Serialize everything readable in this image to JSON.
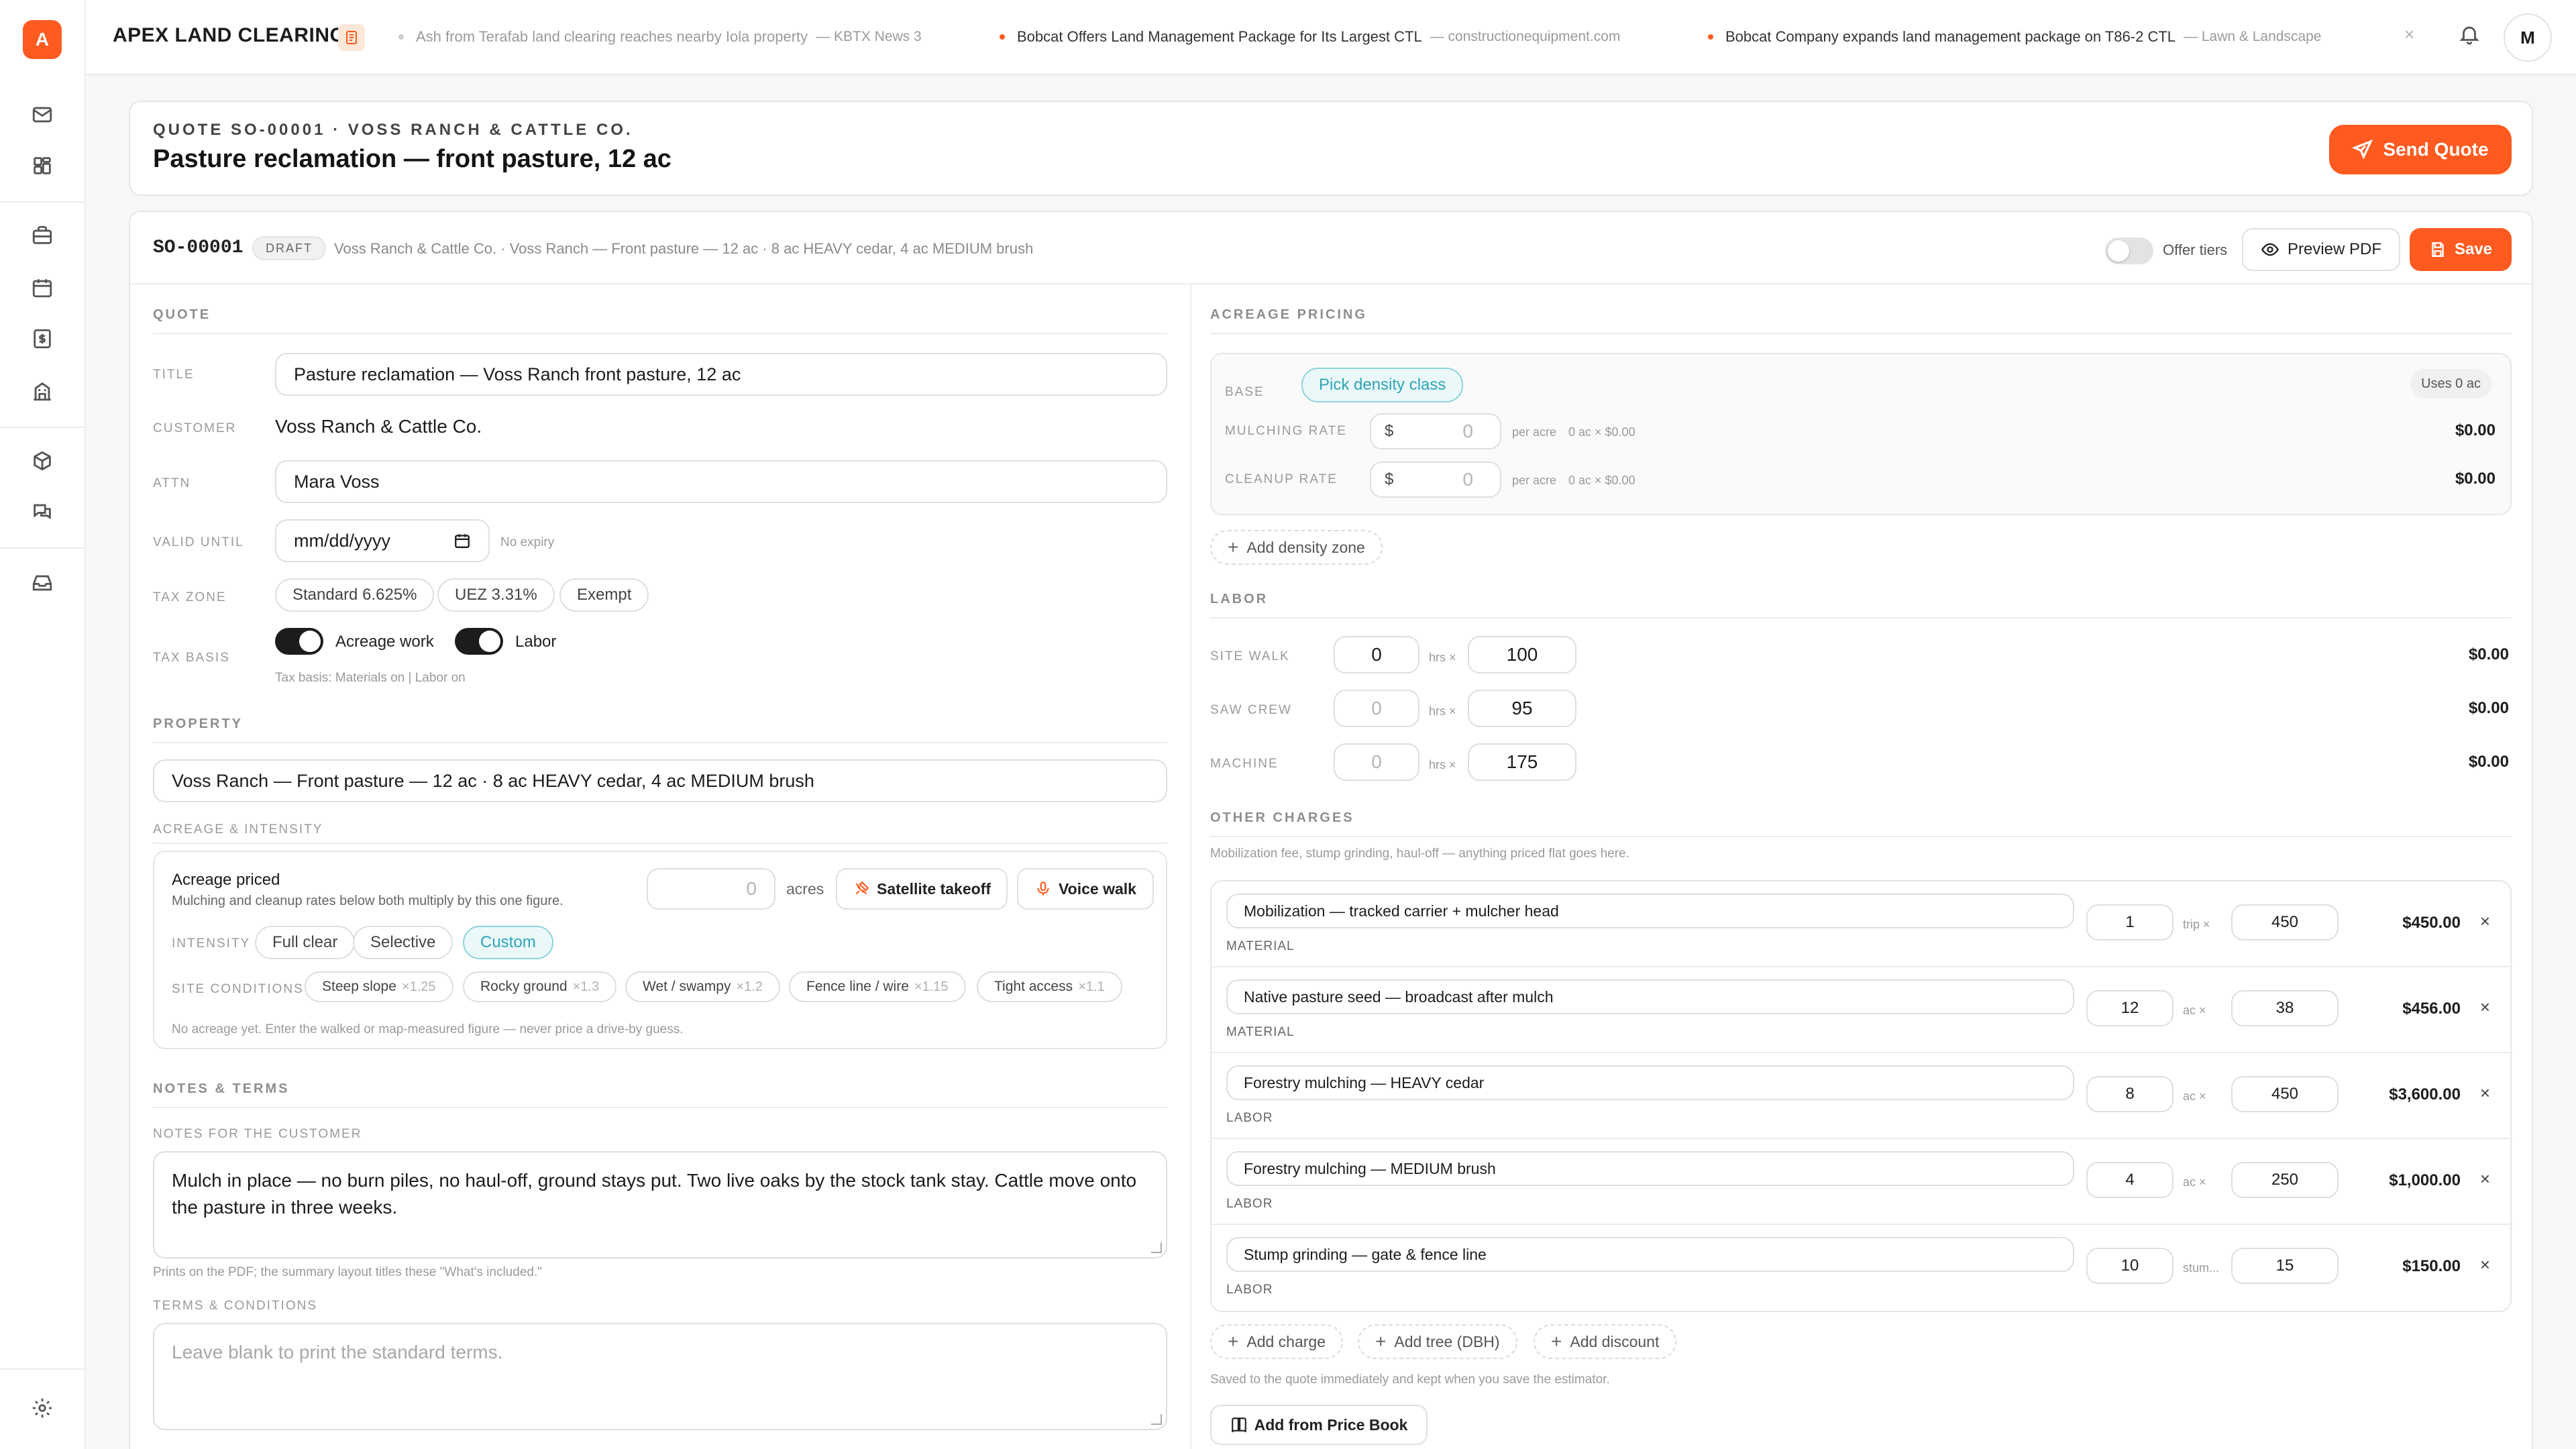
{
  "app": {
    "brand": "APEX LAND CLEARING",
    "logo_letter": "A",
    "avatar": "M"
  },
  "ticker": [
    {
      "headline": "Ash from Terafab land clearing reaches nearby Iola property",
      "source": "— KBTX News 3",
      "dot_color": "#cfcfcf",
      "muted": true
    },
    {
      "headline": "Bobcat Offers Land Management Package for Its Largest CTL",
      "source": "— constructionequipment.com",
      "dot_color": "#ff5a1f",
      "muted": false
    },
    {
      "headline": "Bobcat Company expands land management package on T86-2 CTL",
      "source": "— Lawn & Landscape",
      "dot_color": "#ff5a1f",
      "muted": false
    }
  ],
  "header": {
    "kicker": "QUOTE SO-00001 · VOSS RANCH & CATTLE CO.",
    "title": "Pasture reclamation — front pasture, 12 ac",
    "send_label": "Send Quote"
  },
  "meta": {
    "number": "SO-00001",
    "status": "DRAFT",
    "description": "Voss Ranch & Cattle Co. · Voss Ranch — Front pasture — 12 ac · 8 ac HEAVY cedar, 4 ac MEDIUM brush",
    "offer_tiers_label": "Offer tiers",
    "preview_label": "Preview PDF",
    "save_label": "Save"
  },
  "quote": {
    "section": "QUOTE",
    "title_label": "TITLE",
    "title_value": "Pasture reclamation — Voss Ranch front pasture, 12 ac",
    "customer_label": "CUSTOMER",
    "customer_value": "Voss Ranch & Cattle Co.",
    "attn_label": "ATTN",
    "attn_value": "Mara Voss",
    "valid_label": "VALID UNTIL",
    "valid_placeholder": "mm/dd/yyyy",
    "valid_hint": "No expiry",
    "tax_zone_label": "TAX ZONE",
    "tax_zones": [
      "Standard 6.625%",
      "UEZ 3.31%",
      "Exempt"
    ],
    "tax_basis_label": "TAX BASIS",
    "tax_acreage": "Acreage work",
    "tax_labor": "Labor",
    "tax_hint": "Tax basis: Materials on | Labor on"
  },
  "property": {
    "section": "PROPERTY",
    "value": "Voss Ranch — Front pasture — 12 ac · 8 ac HEAVY cedar, 4 ac MEDIUM brush",
    "acreage_section": "ACREAGE & INTENSITY",
    "acreage_title": "Acreage priced",
    "acreage_sub": "Mulching and cleanup rates below both multiply by this one figure.",
    "acres_value": "0",
    "acres_unit": "acres",
    "satellite_label": "Satellite takeoff",
    "voice_label": "Voice walk",
    "intensity_label": "INTENSITY",
    "intensities": [
      "Full clear",
      "Selective",
      "Custom"
    ],
    "site_label": "SITE CONDITIONS",
    "conditions": [
      {
        "name": "Steep slope",
        "mult": "×1.25"
      },
      {
        "name": "Rocky ground",
        "mult": "×1.3"
      },
      {
        "name": "Wet / swampy",
        "mult": "×1.2"
      },
      {
        "name": "Fence line / wire",
        "mult": "×1.15"
      },
      {
        "name": "Tight access",
        "mult": "×1.1"
      }
    ],
    "acreage_hint": "No acreage yet. Enter the walked or map-measured figure — never price a drive-by guess."
  },
  "notes": {
    "section": "NOTES & TERMS",
    "customer_label": "NOTES FOR THE CUSTOMER",
    "customer_text": "Mulch in place — no burn piles, no haul-off, ground stays put. Two live oaks by the stock tank stay. Cattle move onto the pasture in three weeks.",
    "customer_hint": "Prints on the PDF; the summary layout titles these \"What's included.\"",
    "terms_label": "TERMS & CONDITIONS",
    "terms_placeholder": "Leave blank to print the standard terms."
  },
  "acreage_pricing": {
    "section": "ACREAGE PRICING",
    "base_label": "BASE",
    "base_pill": "Pick density class",
    "uses": "Uses 0 ac",
    "mulching_label": "MULCHING RATE",
    "cleanup_label": "CLEANUP RATE",
    "currency": "$",
    "mulching_value": "0",
    "cleanup_value": "0",
    "per_acre": "per acre",
    "mulching_calc": "0 ac × $0.00",
    "cleanup_calc": "0 ac × $0.00",
    "mulching_total": "$0.00",
    "cleanup_total": "$0.00",
    "add_zone": "Add density zone"
  },
  "labor": {
    "section": "LABOR",
    "rows": [
      {
        "label": "SITE WALK",
        "hours": "0",
        "rate": "100",
        "total": "$0.00"
      },
      {
        "label": "SAW CREW",
        "hours": "0",
        "rate": "95",
        "total": "$0.00"
      },
      {
        "label": "MACHINE",
        "hours": "0",
        "rate": "175",
        "total": "$0.00"
      }
    ],
    "unit": "hrs ×"
  },
  "other": {
    "section": "OTHER CHARGES",
    "hint": "Mobilization fee, stump grinding, haul-off — anything priced flat goes here.",
    "rows": [
      {
        "desc": "Mobilization — tracked carrier + mulcher head",
        "type": "MATERIAL",
        "qty": "1",
        "unit": "trip ×",
        "rate": "450",
        "total": "$450.00"
      },
      {
        "desc": "Native pasture seed — broadcast after mulch",
        "type": "MATERIAL",
        "qty": "12",
        "unit": "ac ×",
        "rate": "38",
        "total": "$456.00"
      },
      {
        "desc": "Forestry mulching — HEAVY cedar",
        "type": "LABOR",
        "qty": "8",
        "unit": "ac ×",
        "rate": "450",
        "total": "$3,600.00"
      },
      {
        "desc": "Forestry mulching — MEDIUM brush",
        "type": "LABOR",
        "qty": "4",
        "unit": "ac ×",
        "rate": "250",
        "total": "$1,000.00"
      },
      {
        "desc": "Stump grinding — gate & fence line",
        "type": "LABOR",
        "qty": "10",
        "unit": "stum...",
        "rate": "15",
        "total": "$150.00"
      }
    ],
    "add_charge": "Add charge",
    "add_tree": "Add tree (DBH)",
    "add_discount": "Add discount",
    "saved_hint": "Saved to the quote immediately and kept when you save the estimator.",
    "price_book": "Add from Price Book"
  },
  "colors": {
    "accent": "#ff5a1f",
    "teal": "#2fa4b8"
  }
}
